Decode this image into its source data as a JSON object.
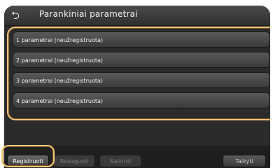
{
  "header": {
    "back_icon": "back-arrow-icon",
    "title": "Parankiniai parametrai"
  },
  "list": {
    "items": [
      {
        "label": "1 parametrai (neužregistruota)"
      },
      {
        "label": "2 parametrai (neužregistruota)"
      },
      {
        "label": "3 parametrai (neužregistruota)"
      },
      {
        "label": "4 parametrai (neužregistruota)"
      }
    ]
  },
  "bottom_bar": {
    "register_label": "Registruoti",
    "edit_label": "Redaguoti",
    "delete_label": "Naikinti",
    "apply_label": "Taikyti"
  },
  "colors": {
    "highlight": "#f2c57c",
    "background": "#2b2b2b"
  }
}
